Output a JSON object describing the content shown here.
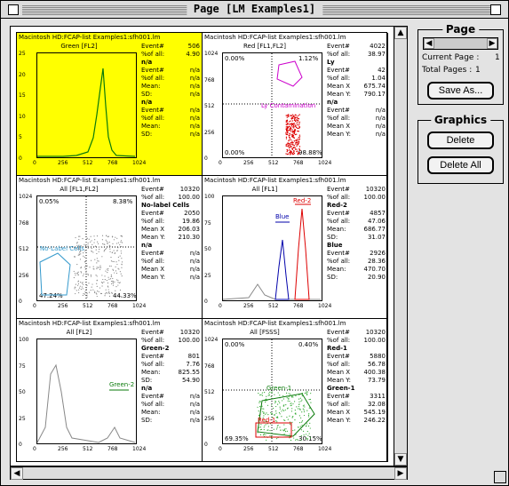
{
  "window": {
    "title": "Page [LM Examples1]"
  },
  "page_panel": {
    "title": "Page",
    "current_label": "Current Page :",
    "current_value": "1",
    "total_label": "Total Pages :",
    "total_value": "1",
    "save_label": "Save As..."
  },
  "graphics_panel": {
    "title": "Graphics",
    "delete_label": "Delete",
    "delete_all_label": "Delete All"
  },
  "cells": [
    {
      "header": "Macintosh HD:FCAP-list Examples1:sfh001.lm",
      "title": "Green [FL2]",
      "stats": [
        [
          "Event#",
          "506"
        ],
        [
          "%of all:",
          "4.90"
        ],
        [
          "n/a",
          ""
        ],
        [
          "Event#",
          "n/a"
        ],
        [
          "%of all:",
          "n/a"
        ],
        [
          "Mean:",
          "n/a"
        ],
        [
          "SD:",
          "n/a"
        ],
        [
          "n/a",
          ""
        ],
        [
          "Event#",
          "n/a"
        ],
        [
          "%of all:",
          "n/a"
        ],
        [
          "Mean:",
          "n/a"
        ],
        [
          "SD:",
          "n/a"
        ]
      ],
      "yticks": [
        "25",
        "20",
        "15",
        "10",
        "5",
        "0"
      ],
      "xticks": [
        "0",
        "256",
        "512",
        "768",
        "1024"
      ]
    },
    {
      "header": "Macintosh HD:FCAP-list Examples1:sfh001.lm",
      "title": "Red [FL1,FL2]",
      "stats": [
        [
          "Event#",
          "4022"
        ],
        [
          "%of all:",
          "38.97"
        ],
        [
          "Ly",
          ""
        ],
        [
          "Event#",
          "42"
        ],
        [
          "%of all:",
          "1.04"
        ],
        [
          "Mean X",
          "675.74"
        ],
        [
          "Mean Y:",
          "790.17"
        ],
        [
          "n/a",
          ""
        ],
        [
          "Event#",
          "n/a"
        ],
        [
          "%of all:",
          "n/a"
        ],
        [
          "Mean X",
          "n/a"
        ],
        [
          "Mean Y:",
          "n/a"
        ]
      ],
      "yticks": [
        "1024",
        "768",
        "512",
        "256",
        "0"
      ],
      "xticks": [
        "0",
        "256",
        "512",
        "768",
        "1024"
      ],
      "labels": {
        "tl": "0.00%",
        "tr": "1.12%",
        "bl": "0.00%",
        "br": "98.88%",
        "gate": "Ly Contamination"
      }
    },
    {
      "header": "Macintosh HD:FCAP-list Examples1:sfh001.lm",
      "title": "All [FL1,FL2]",
      "stats": [
        [
          "Event#",
          "10320"
        ],
        [
          "%of all:",
          "100.00"
        ],
        [
          "No-label Cells",
          ""
        ],
        [
          "Event#",
          "2050"
        ],
        [
          "%of all:",
          "19.86"
        ],
        [
          "Mean X",
          "206.03"
        ],
        [
          "Mean Y:",
          "210.30"
        ],
        [
          "n/a",
          ""
        ],
        [
          "Event#",
          "n/a"
        ],
        [
          "%of all:",
          "n/a"
        ],
        [
          "Mean X",
          "n/a"
        ],
        [
          "Mean Y:",
          "n/a"
        ]
      ],
      "yticks": [
        "1024",
        "768",
        "512",
        "256",
        "0"
      ],
      "xticks": [
        "0",
        "256",
        "512",
        "768",
        "1024"
      ],
      "labels": {
        "tl": "0.05%",
        "tr": "8.38%",
        "bl": "47.24%",
        "br": "44.33%",
        "gate": "No-Label Cells"
      }
    },
    {
      "header": "Macintosh HD:FCAP-list Examples1:sfh001.lm",
      "title": "All [FL1]",
      "stats": [
        [
          "Event#",
          "10320"
        ],
        [
          "%of all:",
          "100.00"
        ],
        [
          "Red-2",
          ""
        ],
        [
          "Event#",
          "4857"
        ],
        [
          "%of all:",
          "47.06"
        ],
        [
          "Mean:",
          "686.77"
        ],
        [
          "SD:",
          "31.07"
        ],
        [
          "Blue",
          ""
        ],
        [
          "Event#",
          "2926"
        ],
        [
          "%of all:",
          "28.36"
        ],
        [
          "Mean:",
          "470.70"
        ],
        [
          "SD:",
          "20.90"
        ]
      ],
      "yticks": [
        "100",
        "75",
        "50",
        "25",
        "0"
      ],
      "xticks": [
        "0",
        "256",
        "512",
        "768",
        "1024"
      ],
      "labels": {
        "blue": "Blue",
        "red": "Red-2"
      }
    },
    {
      "header": "Macintosh HD:FCAP-list Examples1:sfh001.lm",
      "title": "All [FL2]",
      "stats": [
        [
          "Event#",
          "10320"
        ],
        [
          "%of all:",
          "100.00"
        ],
        [
          "Green-2",
          ""
        ],
        [
          "Event#",
          "801"
        ],
        [
          "%of all:",
          "7.76"
        ],
        [
          "Mean:",
          "825.55"
        ],
        [
          "SD:",
          "54.90"
        ],
        [
          "n/a",
          ""
        ],
        [
          "Event#",
          "n/a"
        ],
        [
          "%of all:",
          "n/a"
        ],
        [
          "Mean:",
          "n/a"
        ],
        [
          "SD:",
          "n/a"
        ]
      ],
      "yticks": [
        "100",
        "75",
        "50",
        "25",
        "0"
      ],
      "xticks": [
        "0",
        "256",
        "512",
        "768",
        "1024"
      ],
      "labels": {
        "green": "Green-2"
      }
    },
    {
      "header": "Macintosh HD:FCAP-list Examples1:sfh001.lm",
      "title": "All [FSSS]",
      "stats": [
        [
          "Event#",
          "10320"
        ],
        [
          "%of all:",
          "100.00"
        ],
        [
          "Red-1",
          ""
        ],
        [
          "Event#",
          "5880"
        ],
        [
          "%of all:",
          "56.78"
        ],
        [
          "Mean X",
          "400.38"
        ],
        [
          "Mean Y:",
          "73.79"
        ],
        [
          "Green-1",
          ""
        ],
        [
          "Event#",
          "3311"
        ],
        [
          "%of all:",
          "32.08"
        ],
        [
          "Mean X",
          "545.19"
        ],
        [
          "Mean Y:",
          "246.22"
        ]
      ],
      "yticks": [
        "1024",
        "768",
        "512",
        "256",
        "0"
      ],
      "xticks": [
        "0",
        "256",
        "512",
        "768",
        "1024"
      ],
      "labels": {
        "tl": "0.00%",
        "tr": "0.40%",
        "bl": "69.35%",
        "br": "30.15%",
        "green": "Green-1",
        "red": "Red-1"
      }
    }
  ]
}
